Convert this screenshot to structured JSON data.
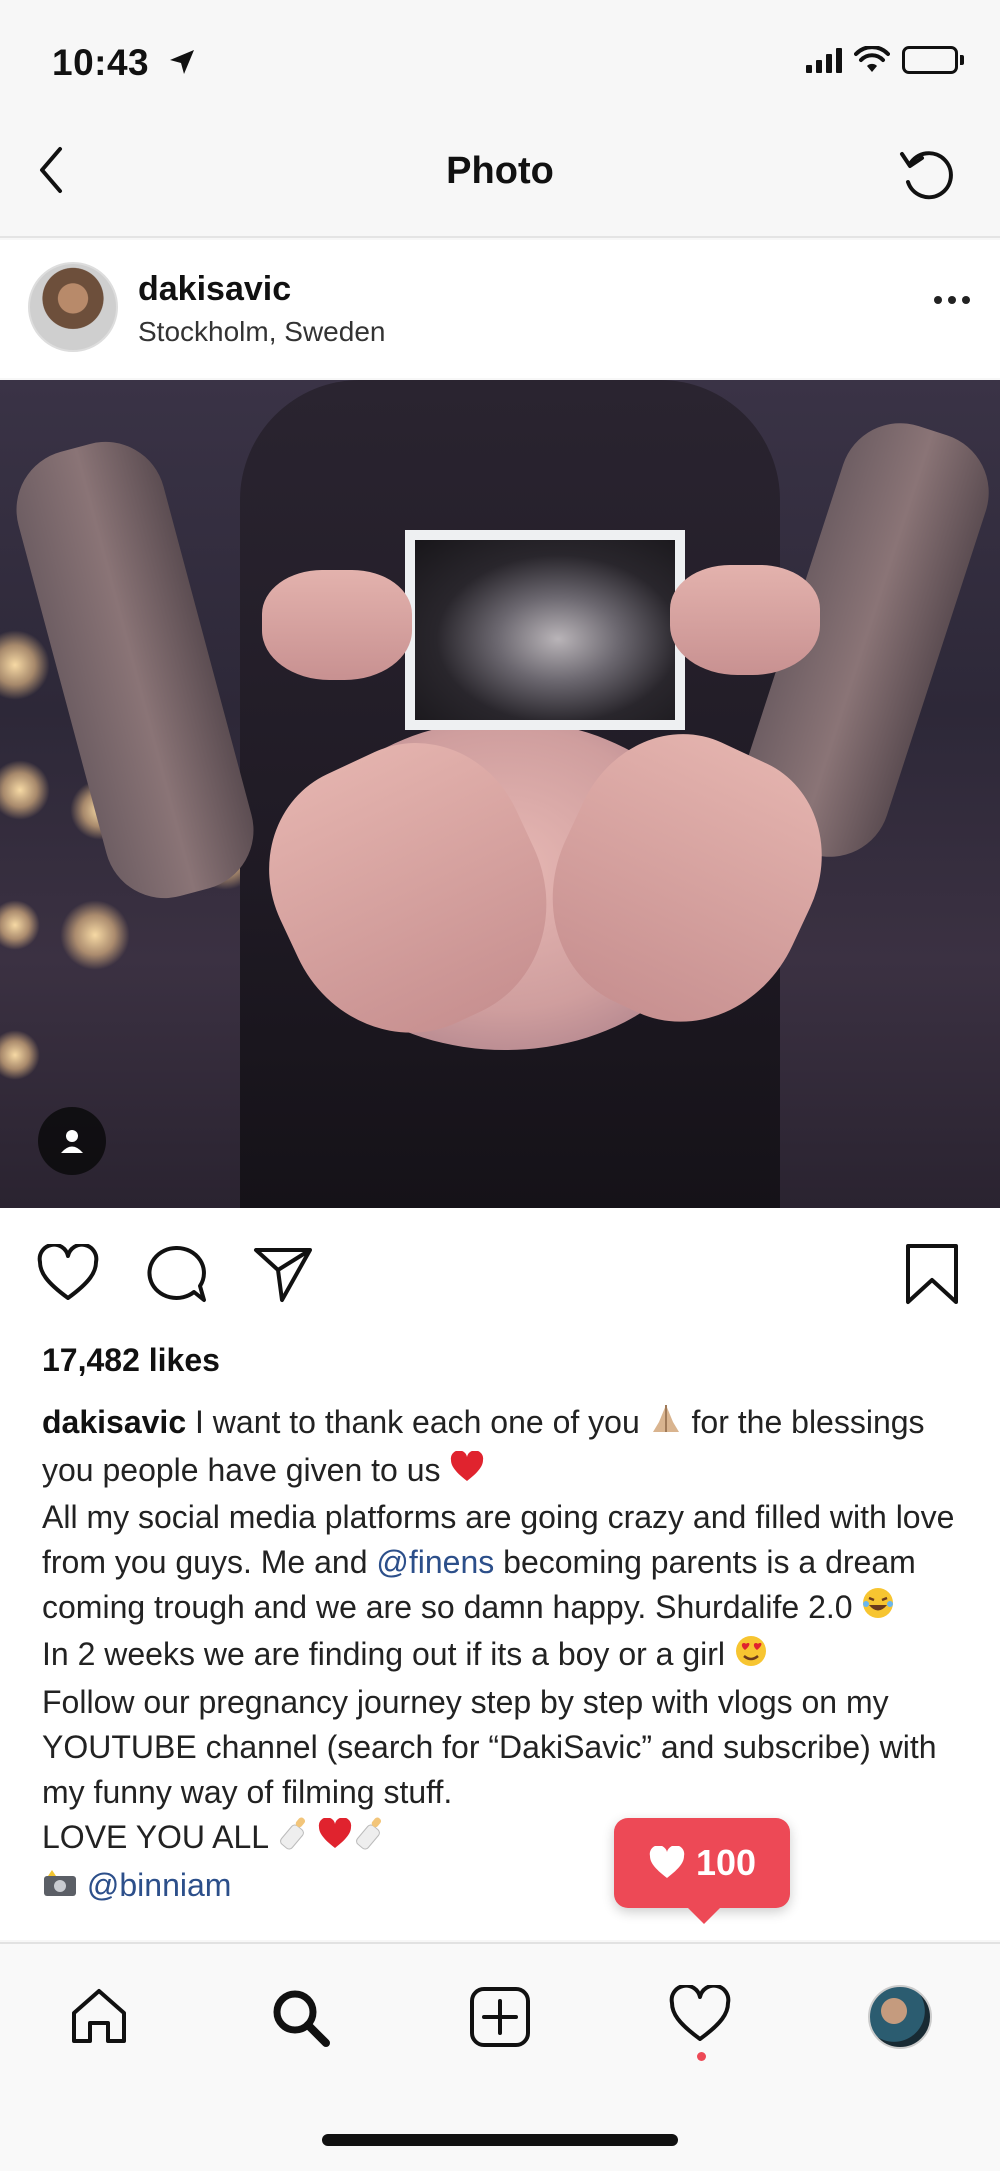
{
  "status_bar": {
    "time": "10:43"
  },
  "nav": {
    "title": "Photo"
  },
  "post": {
    "username": "dakisavic",
    "location": "Stockholm, Sweden",
    "likes": "17,482 likes",
    "caption": {
      "username": "dakisavic",
      "line1": " I want to thank each one of you ",
      "line1b": " for the blessings you people have given to us ",
      "line2": "All my social media platforms are going crazy and filled with love from you guys. Me and ",
      "mention1": "@finens",
      "line3": " becoming parents is a dream coming trough and we are so damn happy. Shurdalife 2.0 ",
      "line4": "In 2 weeks we are finding out if its a boy or a girl ",
      "line5": "Follow our pregnancy journey step by step with vlogs on my YOUTUBE channel (search for “DakiSavic” and subscribe) with my funny way of filming stuff.",
      "line6": "LOVE YOU ALL ",
      "credit": "@binniam"
    }
  },
  "like_notification": {
    "count": "100"
  },
  "colors": {
    "accent": "#ed4956",
    "mention": "#2c4f8a"
  },
  "icons": {
    "nav": [
      "back-chevron-icon",
      "refresh-icon"
    ],
    "actions": [
      "heart-icon",
      "comment-icon",
      "share-icon",
      "bookmark-icon"
    ],
    "tabs": [
      "home-icon",
      "search-icon",
      "new-post-icon",
      "activity-heart-icon",
      "profile-avatar"
    ]
  }
}
